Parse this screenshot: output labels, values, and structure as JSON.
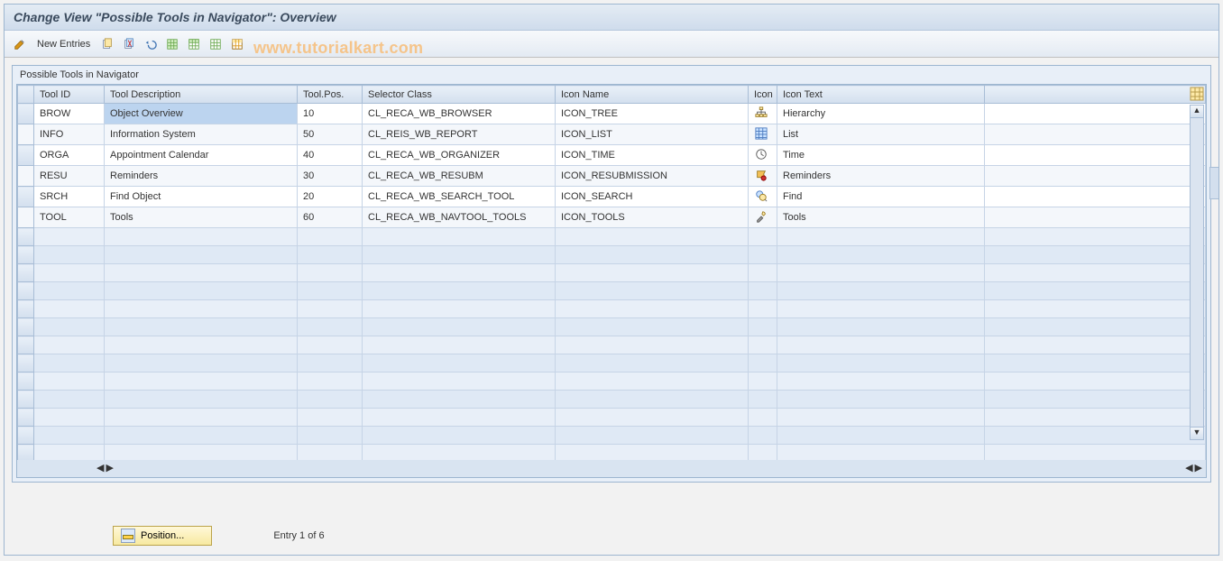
{
  "title": "Change View \"Possible Tools in Navigator\": Overview",
  "watermark": "www.tutorialkart.com",
  "toolbar": {
    "new_entries": "New Entries"
  },
  "panel": {
    "title": "Possible Tools in Navigator"
  },
  "columns": {
    "tool_id": "Tool ID",
    "tool_desc": "Tool Description",
    "tool_pos": "Tool.Pos.",
    "selector_class": "Selector Class",
    "icon_name": "Icon Name",
    "icon": "Icon",
    "icon_text": "Icon Text"
  },
  "rows": [
    {
      "tool_id": "BROW",
      "tool_desc": "Object Overview",
      "tool_pos": "10",
      "selector_class": "CL_RECA_WB_BROWSER",
      "icon_name": "ICON_TREE",
      "icon": "hierarchy",
      "icon_text": "Hierarchy",
      "selected": true
    },
    {
      "tool_id": "INFO",
      "tool_desc": "Information System",
      "tool_pos": "50",
      "selector_class": "CL_REIS_WB_REPORT",
      "icon_name": "ICON_LIST",
      "icon": "list",
      "icon_text": "List"
    },
    {
      "tool_id": "ORGA",
      "tool_desc": "Appointment Calendar",
      "tool_pos": "40",
      "selector_class": "CL_RECA_WB_ORGANIZER",
      "icon_name": "ICON_TIME",
      "icon": "time",
      "icon_text": "Time"
    },
    {
      "tool_id": "RESU",
      "tool_desc": "Reminders",
      "tool_pos": "30",
      "selector_class": "CL_RECA_WB_RESUBM",
      "icon_name": "ICON_RESUBMISSION",
      "icon": "reminders",
      "icon_text": "Reminders"
    },
    {
      "tool_id": "SRCH",
      "tool_desc": "Find Object",
      "tool_pos": "20",
      "selector_class": "CL_RECA_WB_SEARCH_TOOL",
      "icon_name": "ICON_SEARCH",
      "icon": "find",
      "icon_text": "Find"
    },
    {
      "tool_id": "TOOL",
      "tool_desc": "Tools",
      "tool_pos": "60",
      "selector_class": "CL_RECA_WB_NAVTOOL_TOOLS",
      "icon_name": "ICON_TOOLS",
      "icon": "tools",
      "icon_text": "Tools"
    }
  ],
  "empty_row_count": 13,
  "footer": {
    "position_label": "Position...",
    "entry_text": "Entry 1 of 6"
  }
}
